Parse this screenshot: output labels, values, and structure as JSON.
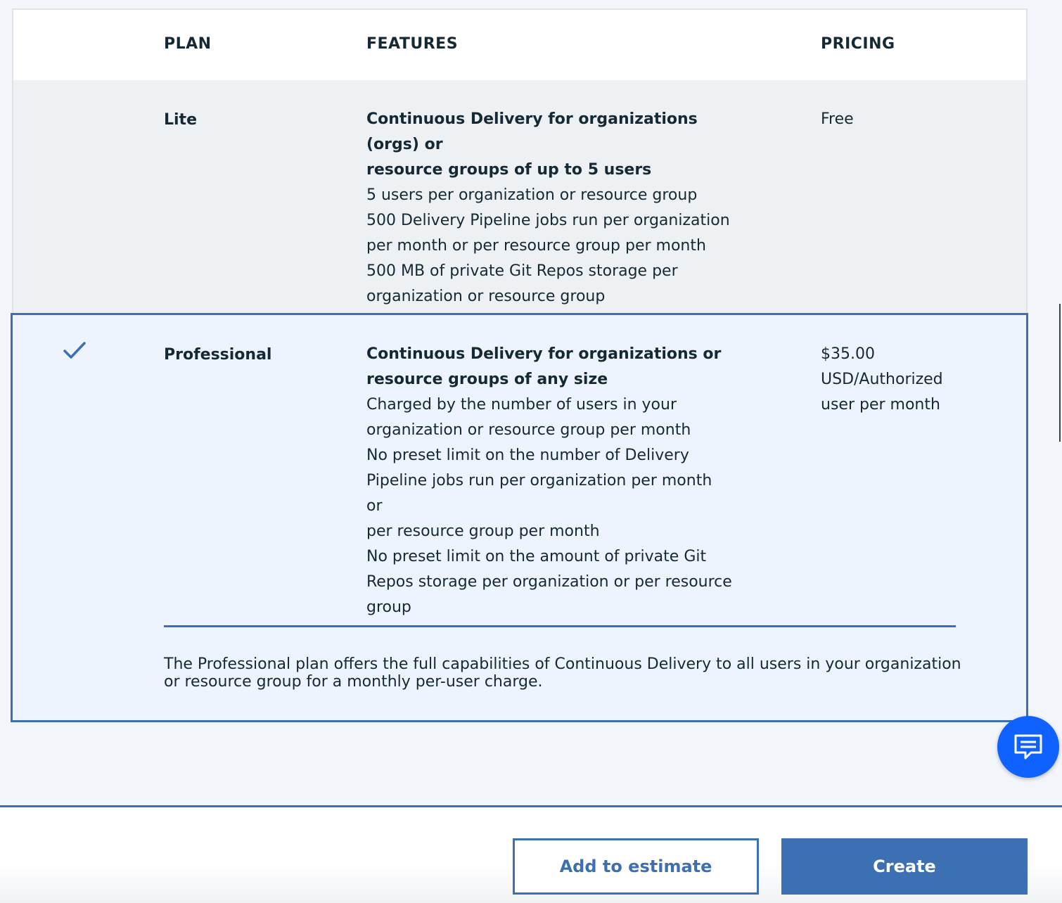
{
  "table": {
    "headers": {
      "plan": "PLAN",
      "features": "FEATURES",
      "pricing": "PRICING"
    },
    "plans": [
      {
        "name": "Lite",
        "feature_title": [
          "Continuous Delivery for organizations (orgs) or",
          "resource groups of up to 5 users"
        ],
        "feature_lines": [
          "5 users per organization or resource group",
          "500 Delivery Pipeline jobs run per organization",
          "per month or per resource group per month",
          "500 MB of private Git Repos storage per",
          "organization or resource group"
        ],
        "price_lines": [
          "Free"
        ],
        "selected": false
      },
      {
        "name": "Professional",
        "feature_title": [
          "Continuous Delivery for organizations or",
          "resource groups of any size"
        ],
        "feature_lines": [
          "Charged by the number of users in your",
          "organization or resource group per month",
          "No preset limit on the number of Delivery",
          "Pipeline jobs run per organization per month or",
          "per resource group per month",
          "No preset limit on the amount of private Git",
          "Repos storage per organization or per resource",
          "group"
        ],
        "price_lines": [
          "$35.00",
          "USD/Authorized",
          "user per month"
        ],
        "selected": true,
        "description": "The Professional plan offers the full capabilities of Continuous Delivery to all users in your organization or resource group for a monthly per-user charge."
      }
    ]
  },
  "footer": {
    "add_to_estimate_label": "Add to estimate",
    "create_label": "Create"
  },
  "icons": {
    "selected_check": "checkmark-icon",
    "chat": "chat-icon"
  },
  "colors": {
    "accent": "#3d70b2",
    "chat_button": "#0f62fe"
  }
}
